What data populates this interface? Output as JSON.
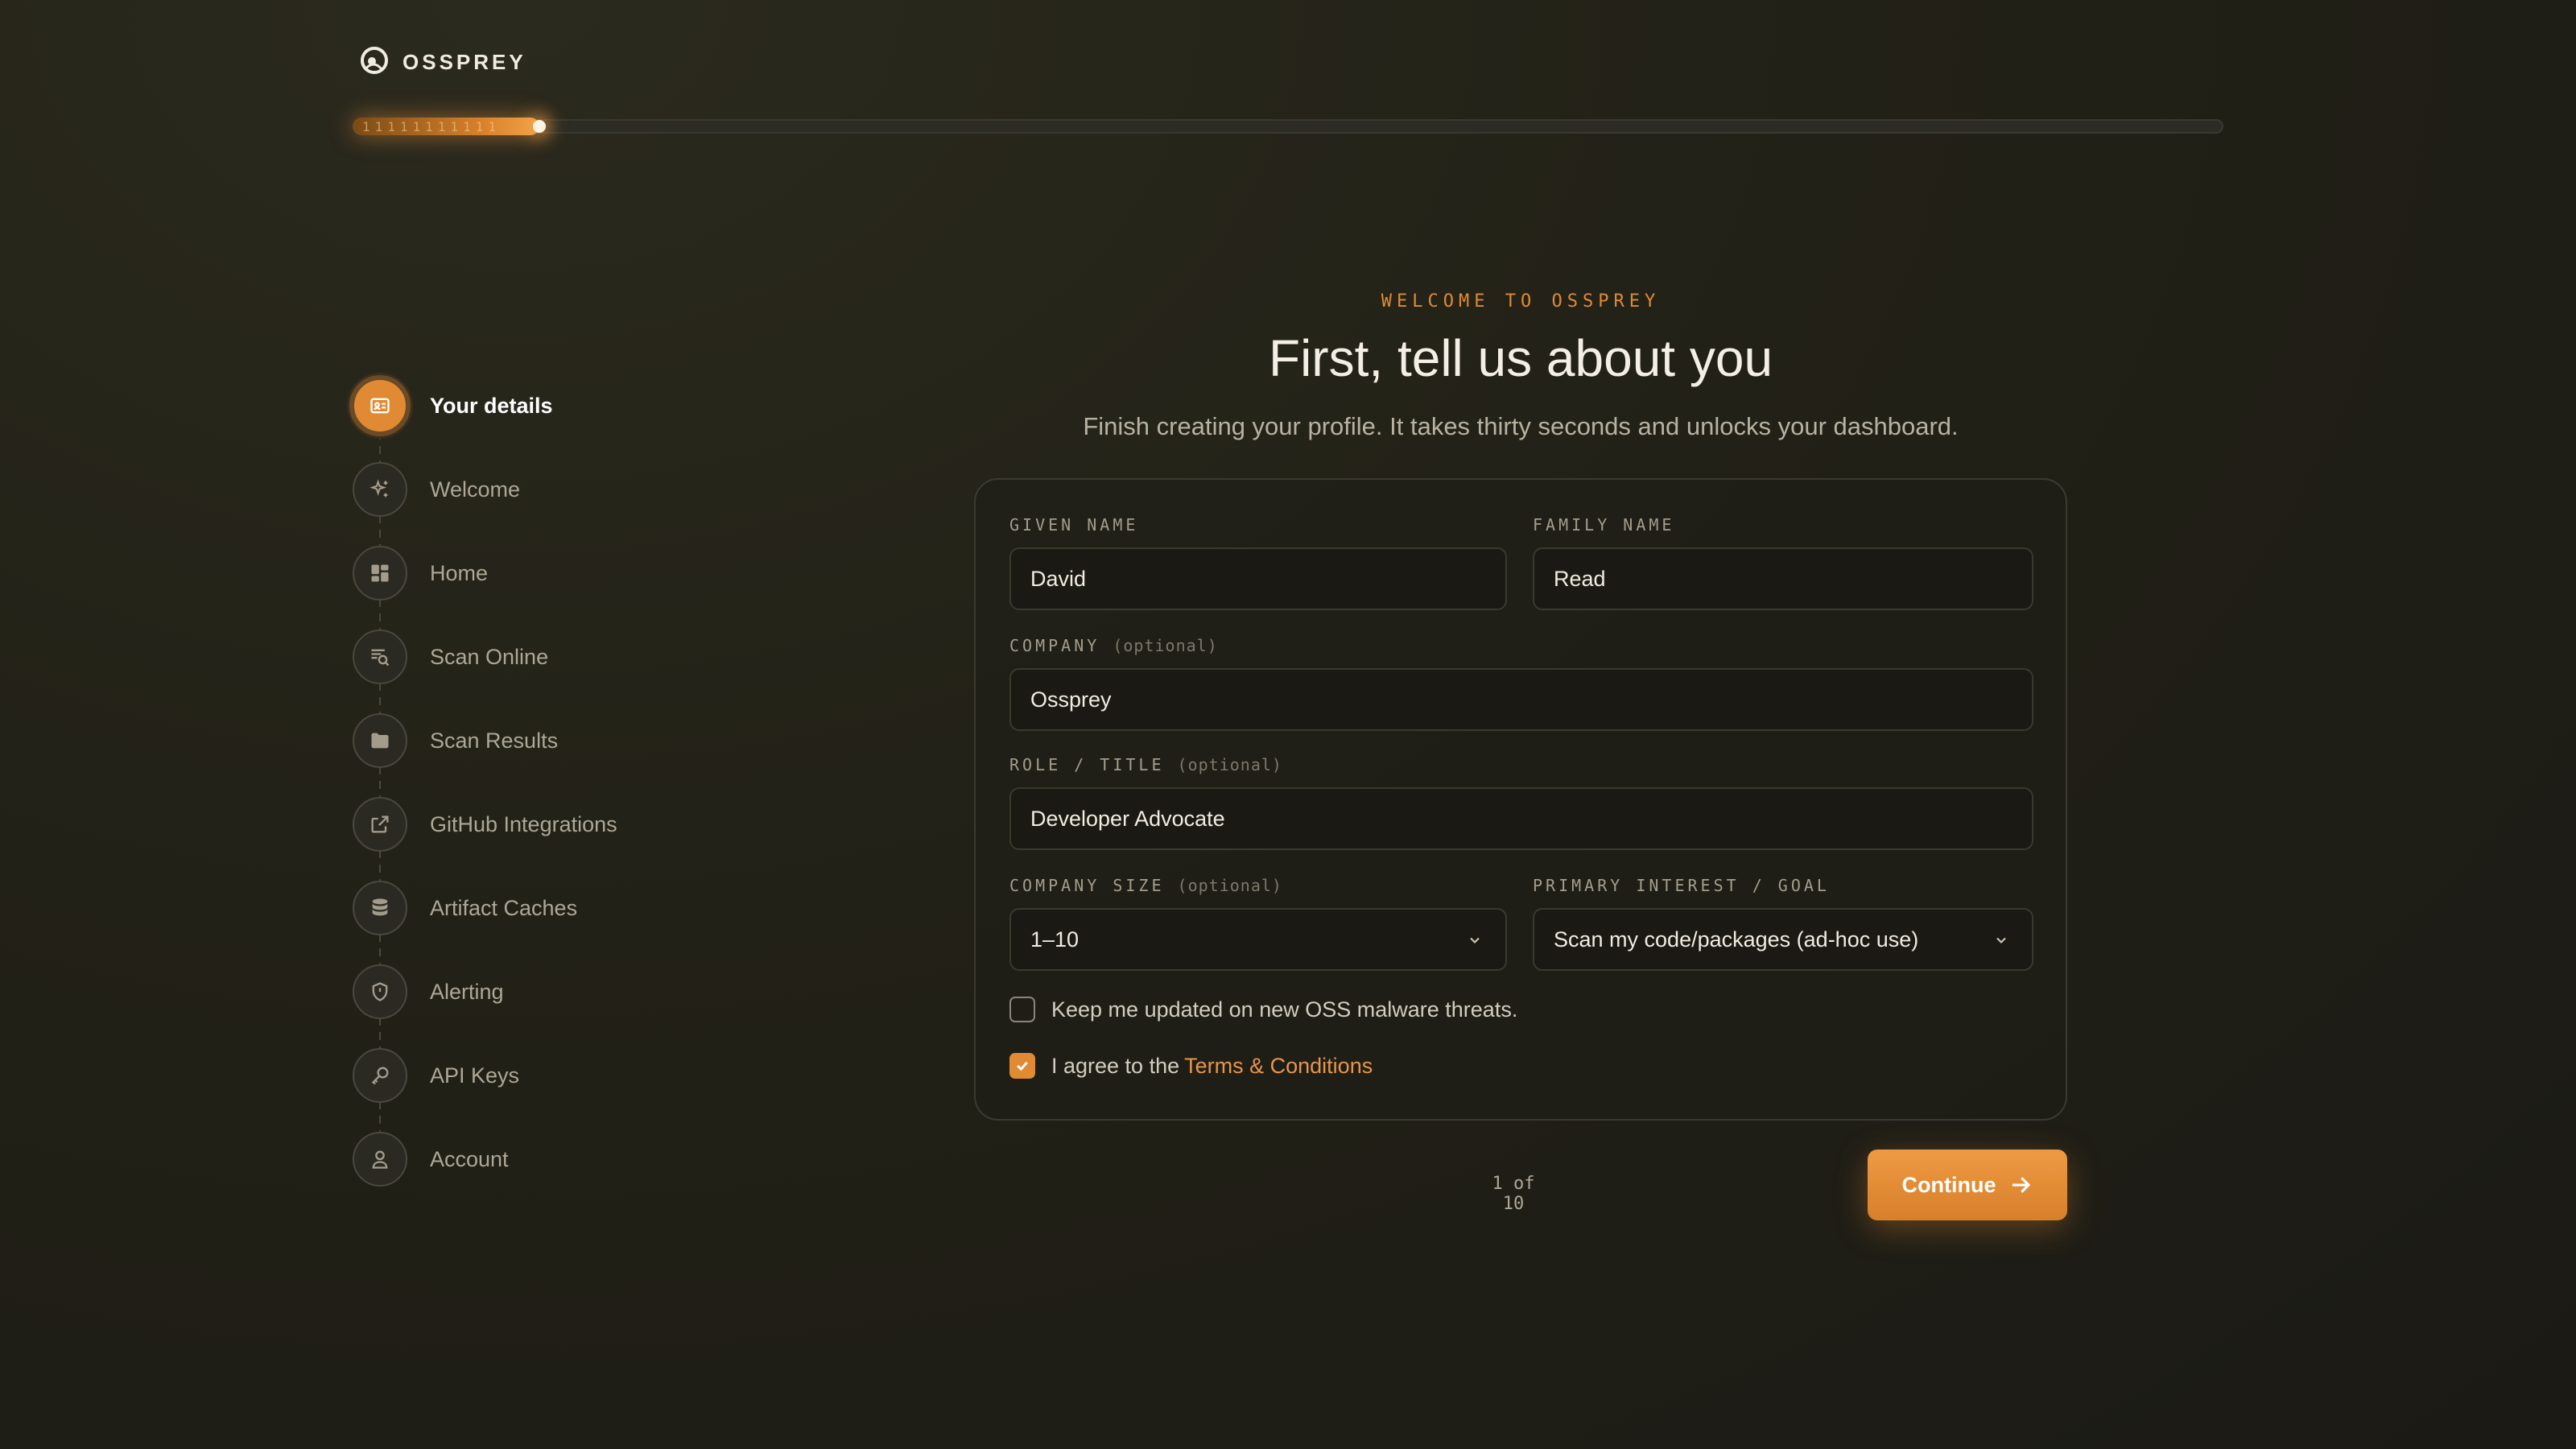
{
  "brand": {
    "name": "OSSPREY"
  },
  "progress": {
    "fraction": 0.1,
    "current": 1,
    "total": 10,
    "ticks": "11111111111",
    "label": "1 of 10"
  },
  "stepper": {
    "steps": [
      {
        "label": "Your details",
        "icon": "id-card-icon",
        "active": true
      },
      {
        "label": "Welcome",
        "icon": "sparkles-icon",
        "active": false
      },
      {
        "label": "Home",
        "icon": "dashboard-icon",
        "active": false
      },
      {
        "label": "Scan Online",
        "icon": "scan-search-icon",
        "active": false
      },
      {
        "label": "Scan Results",
        "icon": "folder-icon",
        "active": false
      },
      {
        "label": "GitHub Integrations",
        "icon": "external-link-icon",
        "active": false
      },
      {
        "label": "Artifact Caches",
        "icon": "database-icon",
        "active": false
      },
      {
        "label": "Alerting",
        "icon": "shield-icon",
        "active": false
      },
      {
        "label": "API Keys",
        "icon": "key-icon",
        "active": false
      },
      {
        "label": "Account",
        "icon": "user-icon",
        "active": false
      }
    ]
  },
  "header": {
    "eyebrow": "WELCOME TO OSSPREY",
    "title": "First, tell us about you",
    "subtitle": "Finish creating your profile. It takes thirty seconds and unlocks your dashboard."
  },
  "form": {
    "given_name": {
      "label": "GIVEN NAME",
      "value": "David"
    },
    "family_name": {
      "label": "FAMILY NAME",
      "value": "Read"
    },
    "company": {
      "label": "COMPANY",
      "optional": "(optional)",
      "value": "Ossprey"
    },
    "role": {
      "label": "ROLE / TITLE",
      "optional": "(optional)",
      "value": "Developer Advocate"
    },
    "company_size": {
      "label": "COMPANY SIZE",
      "optional": "(optional)",
      "value": "1–10"
    },
    "primary_interest": {
      "label": "PRIMARY INTEREST / GOAL",
      "value": "Scan my code/packages (ad-hoc use)"
    },
    "updates_checkbox": {
      "label": "Keep me updated on new OSS malware threats.",
      "checked": false
    },
    "terms_checkbox": {
      "label": "I agree to the",
      "link": "Terms & Conditions",
      "checked": true
    }
  },
  "actions": {
    "continue_label": "Continue"
  },
  "colors": {
    "accent": "#e08a33",
    "background": "#222117",
    "card_border": "#3b3a31"
  }
}
